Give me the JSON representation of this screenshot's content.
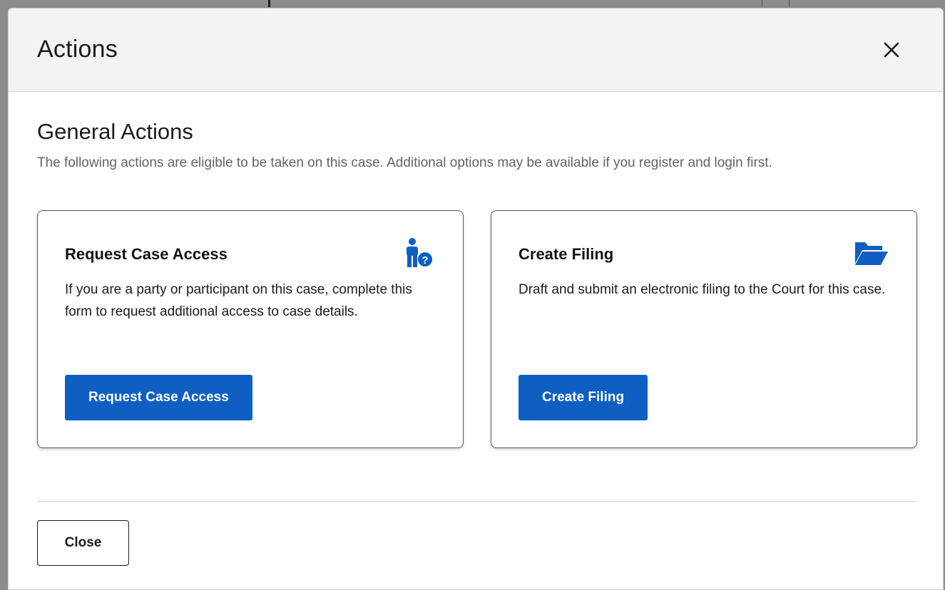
{
  "modal": {
    "title": "Actions",
    "close_icon": "close-icon"
  },
  "section": {
    "title": "General Actions",
    "description": "The following actions are eligible to be taken on this case. Additional options may be available if you register and login first."
  },
  "cards": [
    {
      "title": "Request Case Access",
      "icon": "person-question-icon",
      "description": "If you are a party or participant on this case, complete this form to request additional access to case details.",
      "button_label": "Request Case Access"
    },
    {
      "title": "Create Filing",
      "icon": "folder-open-icon",
      "description": "Draft and submit an electronic filing to the Court for this case.",
      "button_label": "Create Filing"
    }
  ],
  "footer": {
    "close_label": "Close"
  },
  "colors": {
    "primary": "#0f5fc3",
    "header_bg": "#f3f3f3",
    "icon": "#0f5fc3"
  }
}
